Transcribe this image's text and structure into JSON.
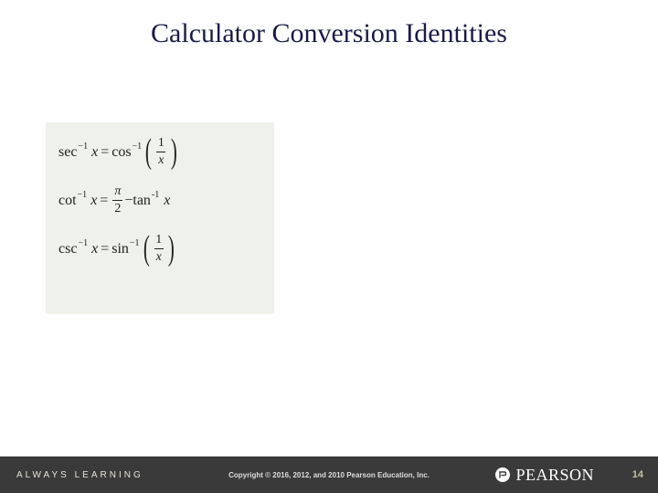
{
  "title": "Calculator Conversion Identities",
  "identities": [
    {
      "lhs_fn": "sec",
      "rhs_fn": "cos",
      "form": "reciprocal"
    },
    {
      "lhs_fn": "cot",
      "rhs_fn": "tan",
      "form": "pi_half_minus"
    },
    {
      "lhs_fn": "csc",
      "rhs_fn": "sin",
      "form": "reciprocal"
    }
  ],
  "eq_parts": {
    "inv_exp": "−1",
    "neg_inv_exp": "-1",
    "x": "x",
    "eq": "=",
    "one": "1",
    "pi": "π",
    "two": "2",
    "minus": " − "
  },
  "footer": {
    "tagline": "ALWAYS LEARNING",
    "copyright": "Copyright © 2016, 2012, and 2010 Pearson Education, Inc.",
    "brand": "PEARSON",
    "pagenum": "14"
  }
}
